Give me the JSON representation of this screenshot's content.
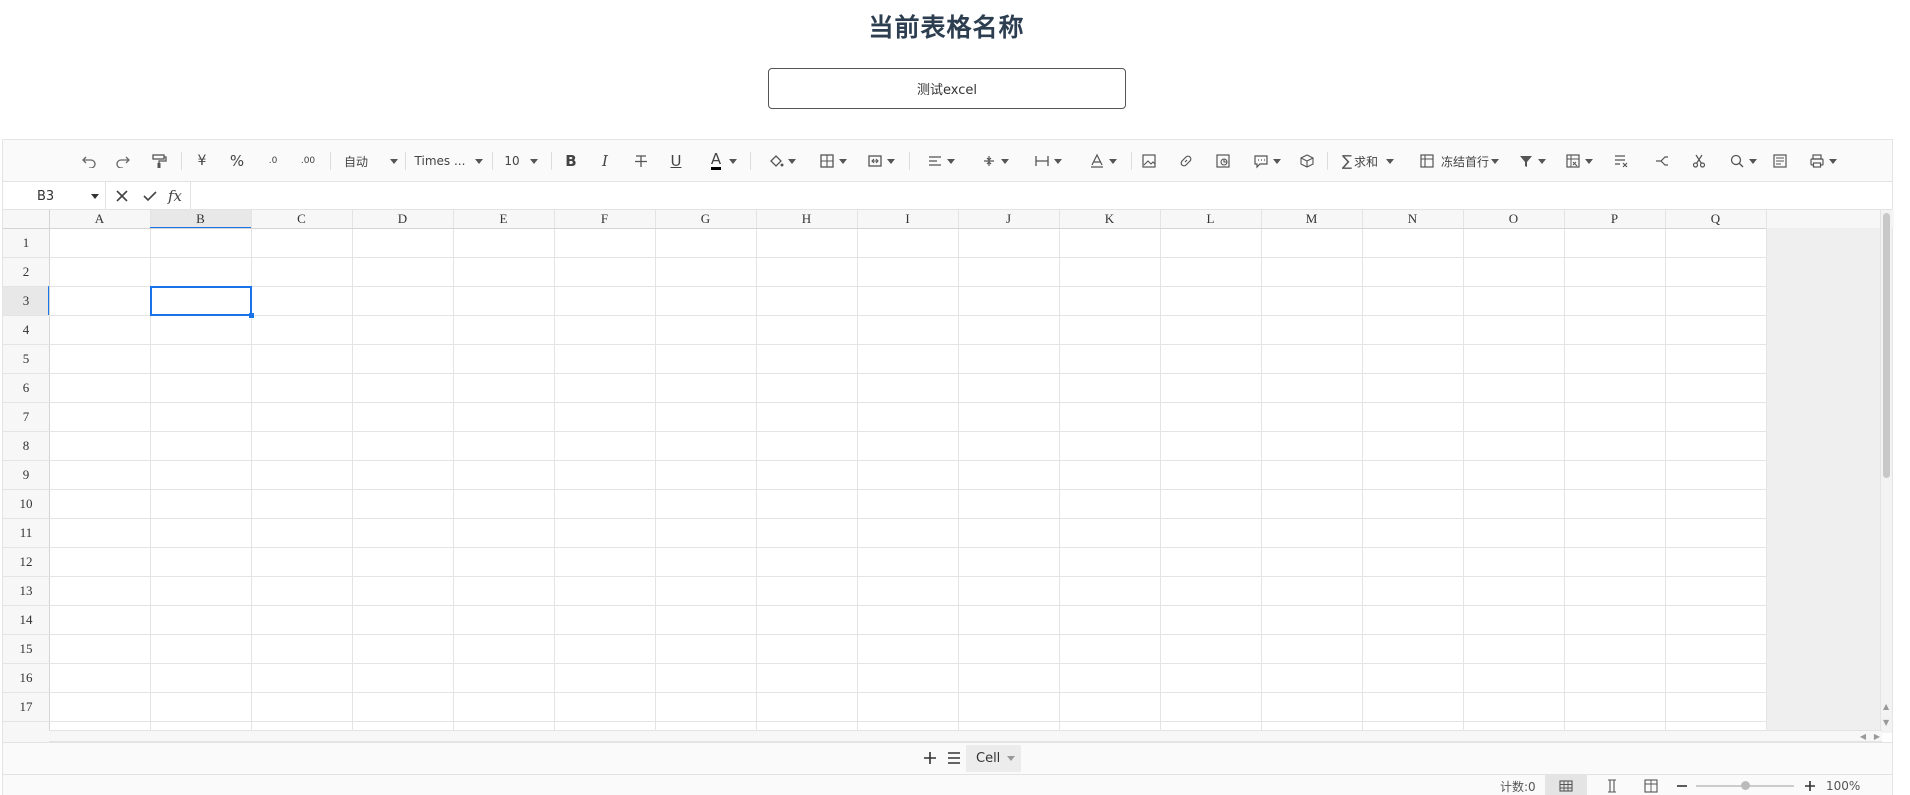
{
  "header": {
    "title": "当前表格名称",
    "sheet_name_value": "测试excel"
  },
  "toolbar": {
    "undo": "undo-icon",
    "redo": "redo-icon",
    "format_painter": "format-painter-icon",
    "currency_label": "¥",
    "percent_label": "%",
    "decimal_decrease_label": ".0",
    "decimal_increase_label": ".00",
    "number_format_value": "自动",
    "font_family_value": "Times ...",
    "font_size_value": "10",
    "bold_label": "B",
    "italic_label": "I",
    "underline_label": "U",
    "font_color_label": "A",
    "sum_label": "求和",
    "freeze_label": "冻结首行"
  },
  "formula_bar": {
    "cell_reference": "B3",
    "cancel": "close-icon",
    "confirm": "check-icon",
    "fx_label": "fx",
    "value": ""
  },
  "grid": {
    "columns": [
      "A",
      "B",
      "C",
      "D",
      "E",
      "F",
      "G",
      "H",
      "I",
      "J",
      "K",
      "L",
      "M",
      "N",
      "O",
      "P",
      "Q"
    ],
    "rows": [
      "1",
      "2",
      "3",
      "4",
      "5",
      "6",
      "7",
      "8",
      "9",
      "10",
      "11",
      "12",
      "13",
      "14",
      "15",
      "16",
      "17"
    ],
    "active_column": "B",
    "active_row": "3"
  },
  "sheets": {
    "tabs": [
      {
        "label": "Cell",
        "active": true
      }
    ]
  },
  "status": {
    "count_label": "计数:0",
    "zoom_label": "100%",
    "zoom_percent": 50
  },
  "colors": {
    "accent": "#1a73e8",
    "title": "#2c3e50",
    "grid_line": "#e4e4e4",
    "header_bg": "#f7f7f7"
  }
}
